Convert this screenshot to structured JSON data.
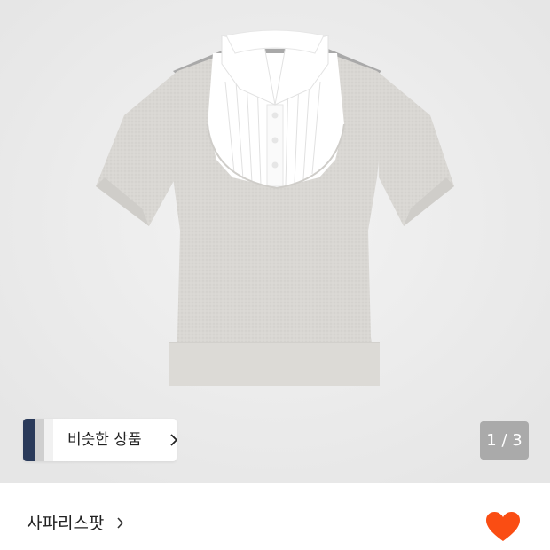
{
  "gallery": {
    "similar_label": "비슷한 상품",
    "counter": "1 / 3"
  },
  "product": {
    "brand": "사파리스팟"
  },
  "colors": {
    "background": "#ebebeb",
    "heart": "#fa4d13",
    "counter_bg": "#8c8c8c",
    "shirt_body": "#d9d7d3",
    "collar": "#ffffff"
  }
}
